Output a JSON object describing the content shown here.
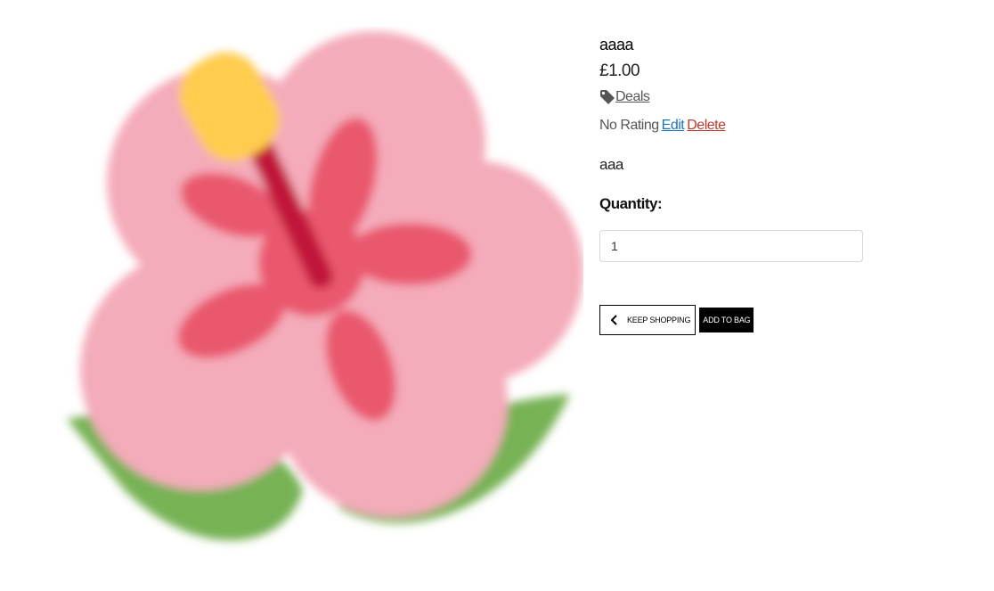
{
  "product": {
    "name": "aaaa",
    "price": "£1.00",
    "category": "Deals",
    "rating_text": "No Rating",
    "edit_label": "Edit",
    "delete_label": "Delete",
    "description": "aaa",
    "image_icon": "hibiscus-flower-image"
  },
  "form": {
    "quantity_label": "Quantity:",
    "quantity_value": "1",
    "keep_shopping_label": "Keep Shopping",
    "add_to_bag_label": "Add to Bag"
  },
  "colors": {
    "edit_link": "#1e73be",
    "delete_link": "#c0392b",
    "add_button_bg": "#000000"
  }
}
